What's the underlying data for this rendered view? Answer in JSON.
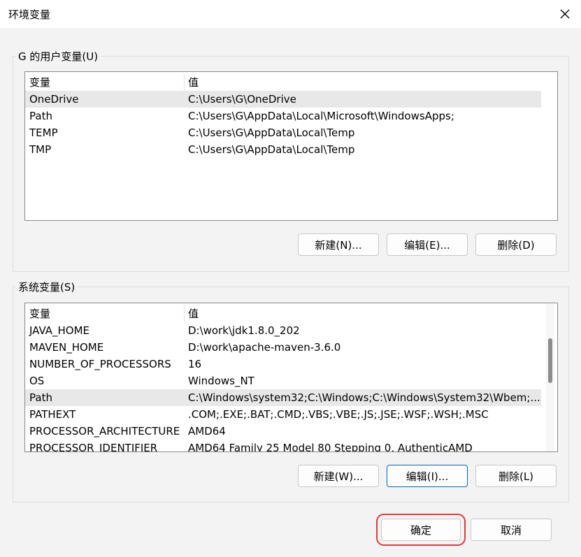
{
  "window": {
    "title": "环境变量"
  },
  "user_group": {
    "label": "G 的用户变量(U)",
    "headers": {
      "name": "变量",
      "value": "值"
    },
    "rows": [
      {
        "name": "OneDrive",
        "value": "C:\\Users\\G\\OneDrive"
      },
      {
        "name": "Path",
        "value": "C:\\Users\\G\\AppData\\Local\\Microsoft\\WindowsApps;"
      },
      {
        "name": "TEMP",
        "value": "C:\\Users\\G\\AppData\\Local\\Temp"
      },
      {
        "name": "TMP",
        "value": "C:\\Users\\G\\AppData\\Local\\Temp"
      }
    ],
    "buttons": {
      "new": "新建(N)...",
      "edit": "编辑(E)...",
      "delete": "删除(D)"
    }
  },
  "system_group": {
    "label": "系统变量(S)",
    "headers": {
      "name": "变量",
      "value": "值"
    },
    "rows": [
      {
        "name": "JAVA_HOME",
        "value": "D:\\work\\jdk1.8.0_202"
      },
      {
        "name": "MAVEN_HOME",
        "value": "D:\\work\\apache-maven-3.6.0"
      },
      {
        "name": "NUMBER_OF_PROCESSORS",
        "value": "16"
      },
      {
        "name": "OS",
        "value": "Windows_NT"
      },
      {
        "name": "Path",
        "value": "C:\\Windows\\system32;C:\\Windows;C:\\Windows\\System32\\Wbem;..."
      },
      {
        "name": "PATHEXT",
        "value": ".COM;.EXE;.BAT;.CMD;.VBS;.VBE;.JS;.JSE;.WSF;.WSH;.MSC"
      },
      {
        "name": "PROCESSOR_ARCHITECTURE",
        "value": "AMD64"
      },
      {
        "name": "PROCESSOR_IDENTIFIER",
        "value": "AMD64 Family 25 Model 80 Stepping 0, AuthenticAMD"
      }
    ],
    "buttons": {
      "new": "新建(W)...",
      "edit": "编辑(I)...",
      "delete": "删除(L)"
    }
  },
  "footer": {
    "ok": "确定",
    "cancel": "取消"
  },
  "icons": {
    "close": "close-icon"
  },
  "colors": {
    "focus_border": "#0067c0",
    "highlight": "#e03c3c",
    "selected_row": "#e8e8e8"
  }
}
